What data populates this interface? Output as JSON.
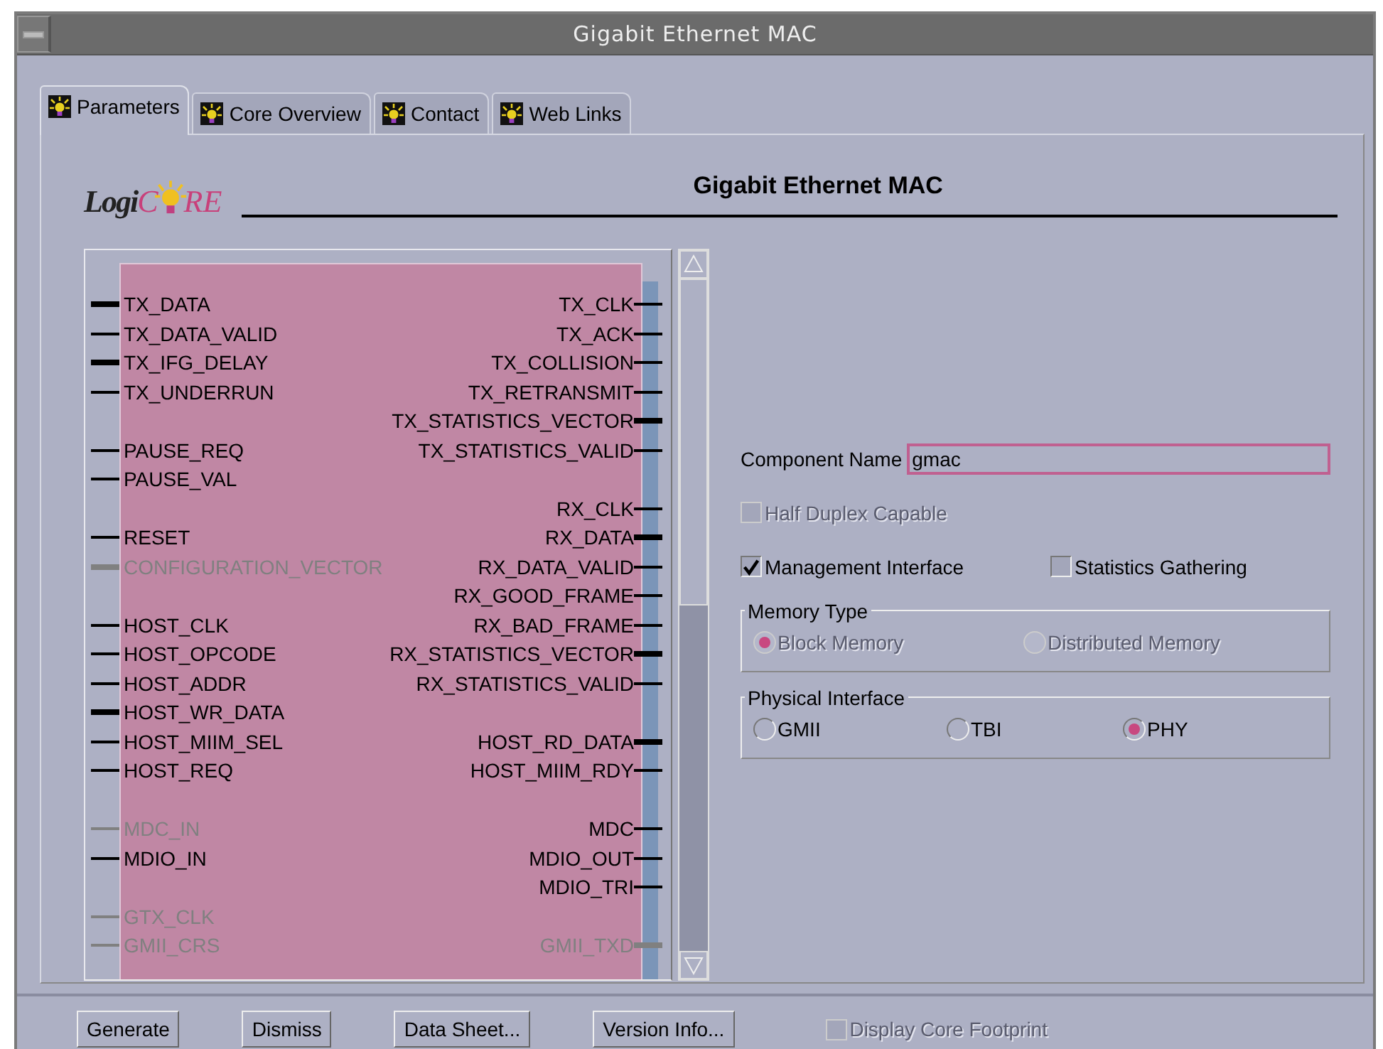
{
  "window": {
    "title": "Gigabit Ethernet MAC"
  },
  "tabs": [
    {
      "label": "Parameters",
      "selected": true
    },
    {
      "label": "Core Overview",
      "selected": false
    },
    {
      "label": "Contact",
      "selected": false
    },
    {
      "label": "Web Links",
      "selected": false
    }
  ],
  "logo": {
    "prefix": "Logi",
    "accent_start": "C",
    "accent_end": "RE"
  },
  "heading": "Gigabit Ethernet MAC",
  "symbol": {
    "rows": [
      {
        "left": {
          "name": "TX_DATA",
          "bus": true,
          "enabled": true
        },
        "right": {
          "name": "TX_CLK",
          "bus": false,
          "enabled": true
        }
      },
      {
        "left": {
          "name": "TX_DATA_VALID",
          "bus": false,
          "enabled": true
        },
        "right": {
          "name": "TX_ACK",
          "bus": false,
          "enabled": true
        }
      },
      {
        "left": {
          "name": "TX_IFG_DELAY",
          "bus": true,
          "enabled": true
        },
        "right": {
          "name": "TX_COLLISION",
          "bus": false,
          "enabled": true
        }
      },
      {
        "left": {
          "name": "TX_UNDERRUN",
          "bus": false,
          "enabled": true
        },
        "right": {
          "name": "TX_RETRANSMIT",
          "bus": false,
          "enabled": true
        }
      },
      {
        "right": {
          "name": "TX_STATISTICS_VECTOR",
          "bus": true,
          "enabled": true
        }
      },
      {
        "left": {
          "name": "PAUSE_REQ",
          "bus": false,
          "enabled": true
        },
        "right": {
          "name": "TX_STATISTICS_VALID",
          "bus": false,
          "enabled": true
        }
      },
      {
        "left": {
          "name": "PAUSE_VAL",
          "bus": false,
          "enabled": true
        }
      },
      {
        "right": {
          "name": "RX_CLK",
          "bus": false,
          "enabled": true
        }
      },
      {
        "left": {
          "name": "RESET",
          "bus": false,
          "enabled": true
        },
        "right": {
          "name": "RX_DATA",
          "bus": true,
          "enabled": true
        }
      },
      {
        "left": {
          "name": "CONFIGURATION_VECTOR",
          "bus": true,
          "enabled": false
        },
        "right": {
          "name": "RX_DATA_VALID",
          "bus": false,
          "enabled": true
        }
      },
      {
        "right": {
          "name": "RX_GOOD_FRAME",
          "bus": false,
          "enabled": true
        }
      },
      {
        "left": {
          "name": "HOST_CLK",
          "bus": false,
          "enabled": true
        },
        "right": {
          "name": "RX_BAD_FRAME",
          "bus": false,
          "enabled": true
        }
      },
      {
        "left": {
          "name": "HOST_OPCODE",
          "bus": false,
          "enabled": true
        },
        "right": {
          "name": "RX_STATISTICS_VECTOR",
          "bus": true,
          "enabled": true
        }
      },
      {
        "left": {
          "name": "HOST_ADDR",
          "bus": false,
          "enabled": true
        },
        "right": {
          "name": "RX_STATISTICS_VALID",
          "bus": false,
          "enabled": true
        }
      },
      {
        "left": {
          "name": "HOST_WR_DATA",
          "bus": true,
          "enabled": true
        }
      },
      {
        "left": {
          "name": "HOST_MIIM_SEL",
          "bus": false,
          "enabled": true
        },
        "right": {
          "name": "HOST_RD_DATA",
          "bus": true,
          "enabled": true
        }
      },
      {
        "left": {
          "name": "HOST_REQ",
          "bus": false,
          "enabled": true
        },
        "right": {
          "name": "HOST_MIIM_RDY",
          "bus": false,
          "enabled": true
        }
      },
      {},
      {
        "left": {
          "name": "MDC_IN",
          "bus": false,
          "enabled": false
        },
        "right": {
          "name": "MDC",
          "bus": false,
          "enabled": true
        }
      },
      {
        "left": {
          "name": "MDIO_IN",
          "bus": false,
          "enabled": true
        },
        "right": {
          "name": "MDIO_OUT",
          "bus": false,
          "enabled": true
        }
      },
      {
        "right": {
          "name": "MDIO_TRI",
          "bus": false,
          "enabled": true
        }
      },
      {
        "left": {
          "name": "GTX_CLK",
          "bus": false,
          "enabled": false
        }
      },
      {
        "left": {
          "name": "GMII_CRS",
          "bus": false,
          "enabled": false
        },
        "right": {
          "name": "GMII_TXD",
          "bus": true,
          "enabled": false
        }
      }
    ]
  },
  "component_name": {
    "label": "Component Name",
    "value": "gmac"
  },
  "options": [
    {
      "label": "Half Duplex Capable",
      "checked": false,
      "disabled": true
    },
    {
      "label": "Management Interface",
      "checked": true,
      "disabled": false
    },
    {
      "label": "Statistics Gathering",
      "checked": false,
      "disabled": false
    }
  ],
  "groups": [
    {
      "title": "Memory Type",
      "options": [
        {
          "label": "Block Memory",
          "selected": true,
          "disabled": true
        },
        {
          "label": "Distributed Memory",
          "selected": false,
          "disabled": true
        }
      ]
    },
    {
      "title": "Physical Interface",
      "options": [
        {
          "label": "GMII",
          "selected": false,
          "disabled": false
        },
        {
          "label": "TBI",
          "selected": false,
          "disabled": false
        },
        {
          "label": "PHY",
          "selected": true,
          "disabled": false
        }
      ]
    }
  ],
  "buttons": [
    "Generate",
    "Dismiss",
    "Data Sheet...",
    "Version Info..."
  ],
  "footprint": {
    "label": "Display Core Footprint",
    "checked": false,
    "disabled": true
  }
}
